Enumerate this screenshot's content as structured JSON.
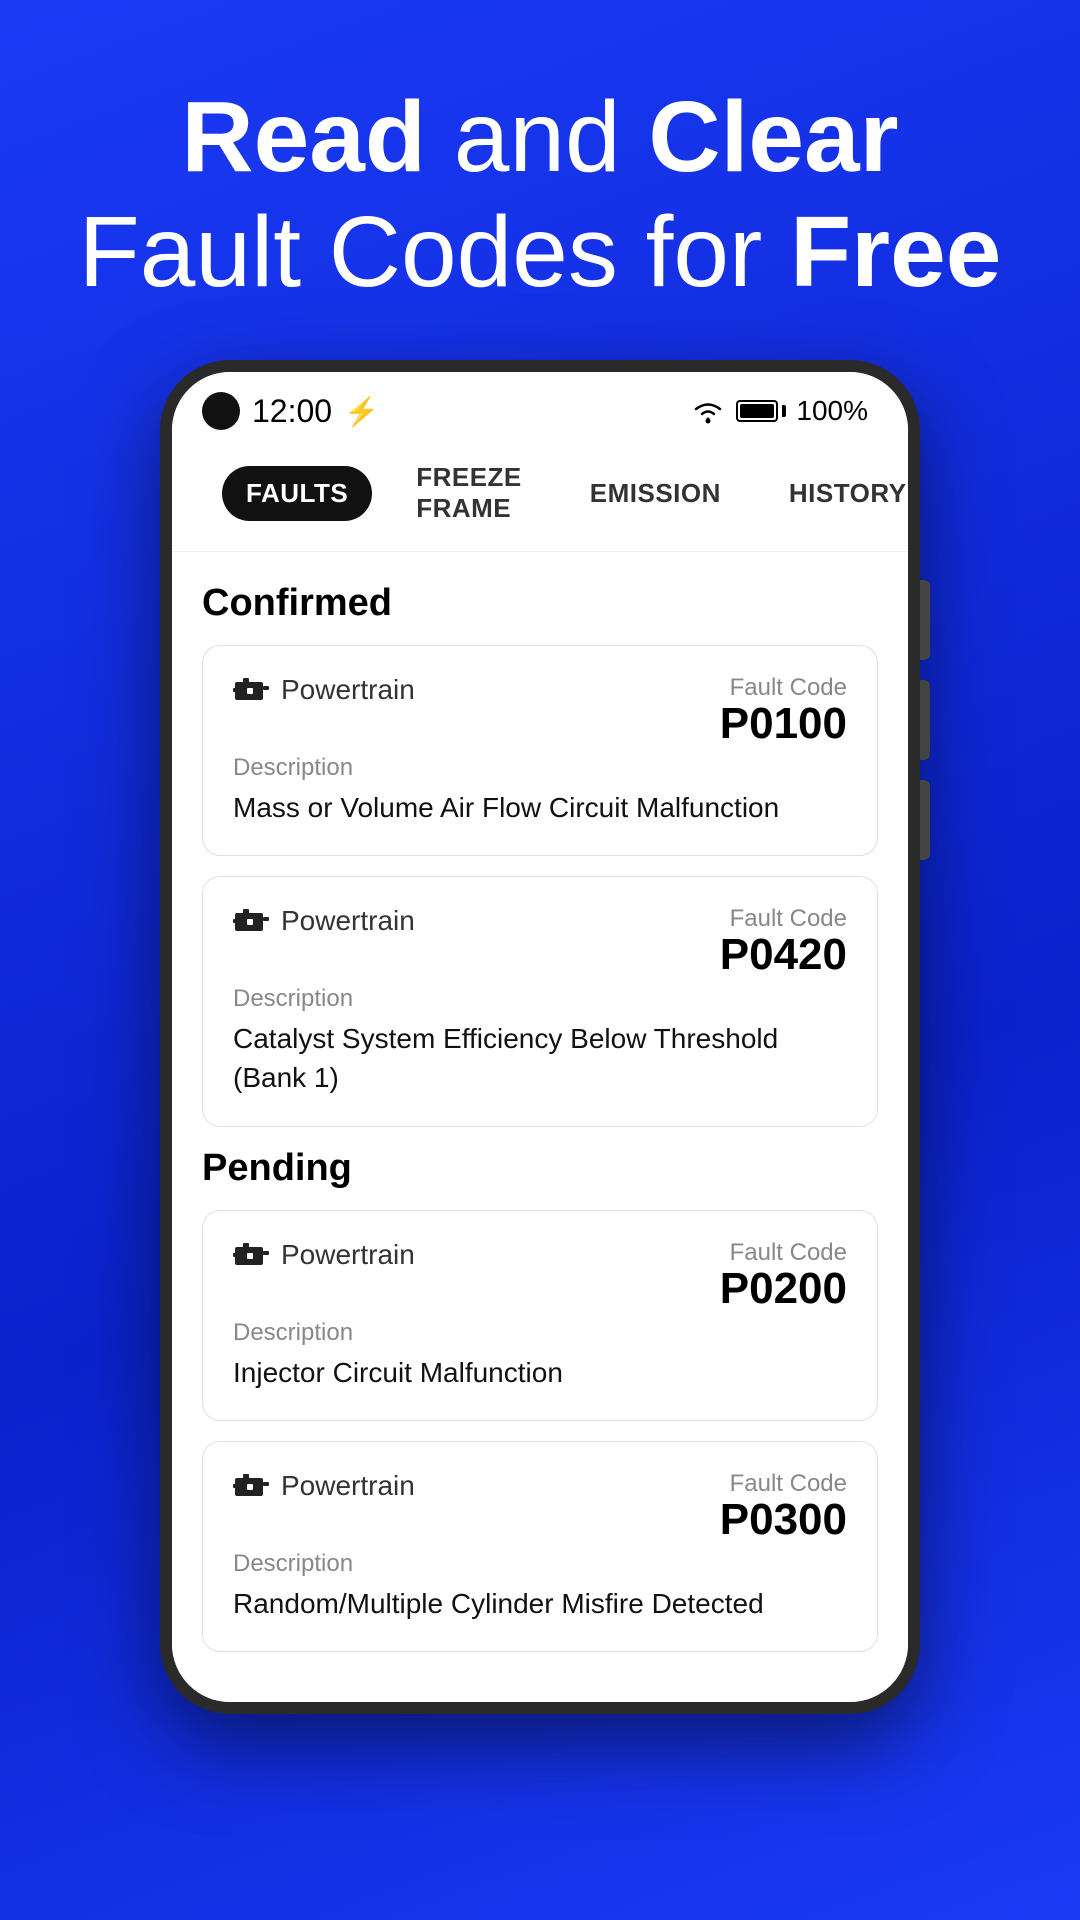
{
  "hero": {
    "line1": "Read and Clear",
    "line1_bold1": "Read",
    "line1_regular": " and ",
    "line1_bold2": "Clear",
    "line2": "Fault Codes for ",
    "line2_bold": "Free"
  },
  "status_bar": {
    "time": "12:00",
    "battery_percent": "100%"
  },
  "nav": {
    "icon_label": "≡",
    "tabs": [
      {
        "label": "Faults",
        "active": true
      },
      {
        "label": "Freeze Frame",
        "active": false
      },
      {
        "label": "Emission",
        "active": false
      },
      {
        "label": "History",
        "active": false
      }
    ]
  },
  "sections": [
    {
      "title": "Confirmed",
      "faults": [
        {
          "system": "Powertrain",
          "fault_code_label": "Fault Code",
          "fault_code": "P0100",
          "description_label": "Description",
          "description": "Mass or Volume Air Flow Circuit Malfunction"
        },
        {
          "system": "Powertrain",
          "fault_code_label": "Fault Code",
          "fault_code": "P0420",
          "description_label": "Description",
          "description": "Catalyst System Efficiency Below Threshold (Bank 1)"
        }
      ]
    },
    {
      "title": "Pending",
      "faults": [
        {
          "system": "Powertrain",
          "fault_code_label": "Fault Code",
          "fault_code": "P0200",
          "description_label": "Description",
          "description": "Injector Circuit Malfunction"
        },
        {
          "system": "Powertrain",
          "fault_code_label": "Fault Code",
          "fault_code": "P0300",
          "description_label": "Description",
          "description": "Random/Multiple Cylinder Misfire Detected"
        }
      ]
    }
  ]
}
